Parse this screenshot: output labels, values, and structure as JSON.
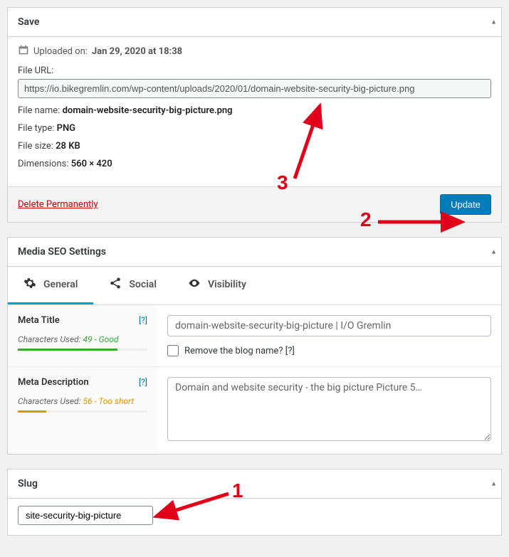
{
  "save": {
    "title": "Save",
    "uploaded_label": "Uploaded on:",
    "uploaded_value": "Jan 29, 2020 at 18:38",
    "file_url_label": "File URL:",
    "file_url_value": "https://io.bikegremlin.com/wp-content/uploads/2020/01/domain-website-security-big-picture.png",
    "file_name_label": "File name:",
    "file_name_value": "domain-website-security-big-picture.png",
    "file_type_label": "File type:",
    "file_type_value": "PNG",
    "file_size_label": "File size:",
    "file_size_value": "28 KB",
    "dimensions_label": "Dimensions:",
    "dimensions_value": "560 × 420",
    "delete_label": "Delete Permanently",
    "update_label": "Update"
  },
  "seo": {
    "title": "Media SEO Settings",
    "tabs": {
      "general": "General",
      "social": "Social",
      "visibility": "Visibility"
    },
    "meta_title": {
      "label": "Meta Title",
      "help": "[?]",
      "chars_label": "Characters Used:",
      "chars_value": "49 - Good",
      "value": "domain-website-security-big-picture | I/O Gremlin",
      "remove_blog_label": "Remove the blog name? [?]"
    },
    "meta_desc": {
      "label": "Meta Description",
      "help": "[?]",
      "chars_label": "Characters Used:",
      "chars_value": "56 - Too short",
      "value": "Domain and website security - the big picture Picture 5…"
    }
  },
  "slug": {
    "title": "Slug",
    "value": "site-security-big-picture"
  },
  "annotations": {
    "n1": "1",
    "n2": "2",
    "n3": "3"
  }
}
